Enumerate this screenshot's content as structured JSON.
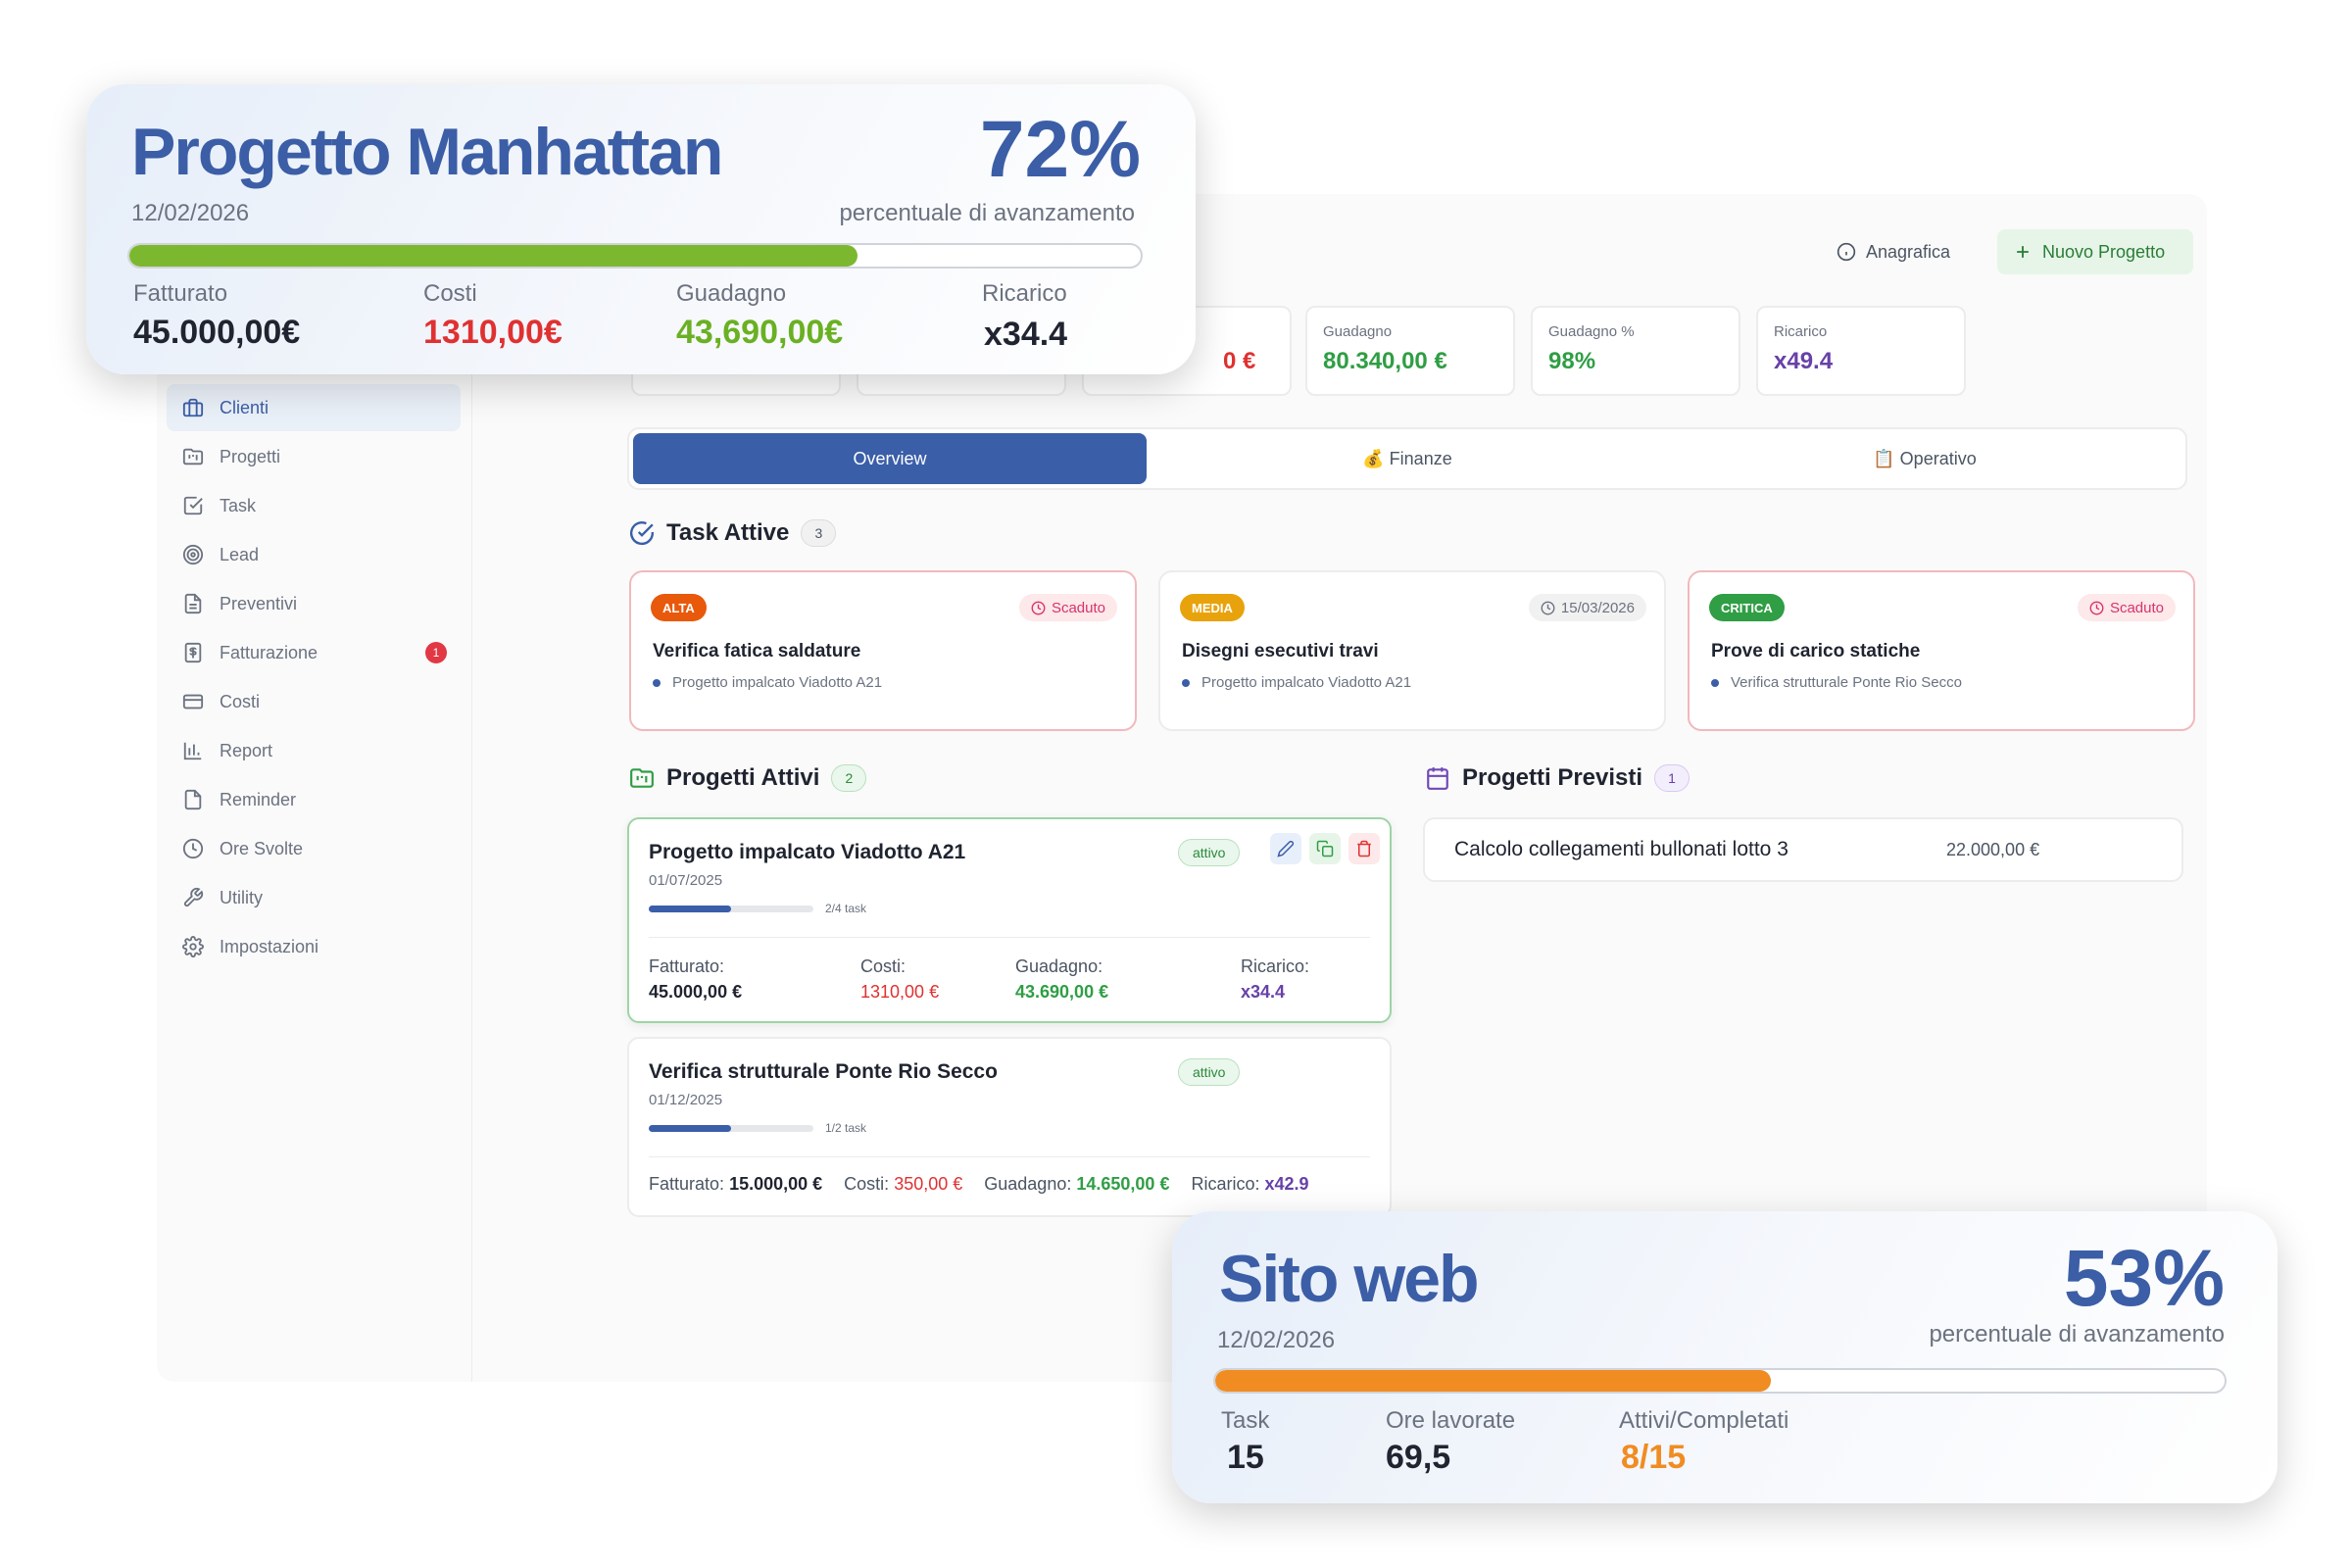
{
  "sidebar": {
    "items": [
      {
        "label": "Clienti",
        "icon": "briefcase-icon"
      },
      {
        "label": "Progetti",
        "icon": "folder-kanban-icon"
      },
      {
        "label": "Task",
        "icon": "checkbox-icon"
      },
      {
        "label": "Lead",
        "icon": "target-icon"
      },
      {
        "label": "Preventivi",
        "icon": "document-icon"
      },
      {
        "label": "Fatturazione",
        "icon": "invoice-icon",
        "badge": "1"
      },
      {
        "label": "Costi",
        "icon": "credit-card-icon"
      },
      {
        "label": "Report",
        "icon": "bar-chart-icon"
      },
      {
        "label": "Reminder",
        "icon": "note-icon"
      },
      {
        "label": "Ore Svolte",
        "icon": "clock-icon"
      },
      {
        "label": "Utility",
        "icon": "wrench-icon"
      },
      {
        "label": "Impostazioni",
        "icon": "gear-icon"
      }
    ]
  },
  "header": {
    "anagrafica_label": "Anagrafica",
    "new_project_label": "Nuovo Progetto"
  },
  "stats": {
    "partial_value": "0 €",
    "guadagno_label": "Guadagno",
    "guadagno_value": "80.340,00 €",
    "guadagno_pct_label": "Guadagno %",
    "guadagno_pct_value": "98%",
    "ricarico_label": "Ricarico",
    "ricarico_value": "x49.4"
  },
  "tabs": {
    "overview": "Overview",
    "finanze": "💰 Finanze",
    "operativo": "📋 Operativo"
  },
  "task_section": {
    "title": "Task Attive",
    "count": "3",
    "tasks": [
      {
        "priority": "ALTA",
        "due": "Scaduto",
        "title": "Verifica fatica saldature",
        "project": "Progetto impalcato Viadotto A21"
      },
      {
        "priority": "MEDIA",
        "due": "15/03/2026",
        "title": "Disegni esecutivi travi",
        "project": "Progetto impalcato Viadotto A21"
      },
      {
        "priority": "CRITICA",
        "due": "Scaduto",
        "title": "Prove di carico statiche",
        "project": "Verifica strutturale Ponte Rio Secco"
      }
    ]
  },
  "active_projects": {
    "title": "Progetti Attivi",
    "count": "2",
    "projects": [
      {
        "title": "Progetto impalcato Viadotto A21",
        "date": "01/07/2025",
        "status": "attivo",
        "tasks": "2/4 task",
        "progress": 0.5,
        "fatturato_label": "Fatturato:",
        "fatturato": "45.000,00 €",
        "costi_label": "Costi:",
        "costi": "1310,00 €",
        "guadagno_label": "Guadagno:",
        "guadagno": "43.690,00 €",
        "ricarico_label": "Ricarico:",
        "ricarico": "x34.4"
      },
      {
        "title": "Verifica strutturale Ponte Rio Secco",
        "date": "01/12/2025",
        "status": "attivo",
        "tasks": "1/2 task",
        "progress": 0.5,
        "fatturato_label": "Fatturato:",
        "fatturato": "15.000,00 €",
        "costi_label": "Costi:",
        "costi": "350,00 €",
        "guadagno_label": "Guadagno:",
        "guadagno": "14.650,00 €",
        "ricarico_label": "Ricarico:",
        "ricarico": "x42.9"
      }
    ]
  },
  "planned_projects": {
    "title": "Progetti Previsti",
    "count": "1",
    "items": [
      {
        "title": "Calcolo collegamenti bullonati lotto 3",
        "amount": "22.000,00 €"
      }
    ]
  },
  "overlay_manhattan": {
    "title": "Progetto Manhattan",
    "date": "12/02/2026",
    "percent": "72%",
    "percent_label": "percentuale di avanzamento",
    "progress": 0.72,
    "fatturato_label": "Fatturato",
    "fatturato": "45.000,00€",
    "costi_label": "Costi",
    "costi": "1310,00€",
    "guadagno_label": "Guadagno",
    "guadagno": "43,690,00€",
    "ricarico_label": "Ricarico",
    "ricarico": "x34.4"
  },
  "overlay_sito": {
    "title": "Sito web",
    "date": "12/02/2026",
    "percent": "53%",
    "percent_label": "percentuale di avanzamento",
    "progress": 0.55,
    "task_label": "Task",
    "task": "15",
    "ore_label": "Ore lavorate",
    "ore": "69,5",
    "attivi_label": "Attivi/Completati",
    "attivi": "8/15"
  },
  "colors": {
    "brand_blue": "#3a5ea8",
    "green": "#2f9e44",
    "red": "#e03131",
    "purple": "#6741a8",
    "manhattan_bar": "#7cb82f",
    "sito_bar": "#f08c22",
    "attivi_orange": "#f08c22"
  }
}
